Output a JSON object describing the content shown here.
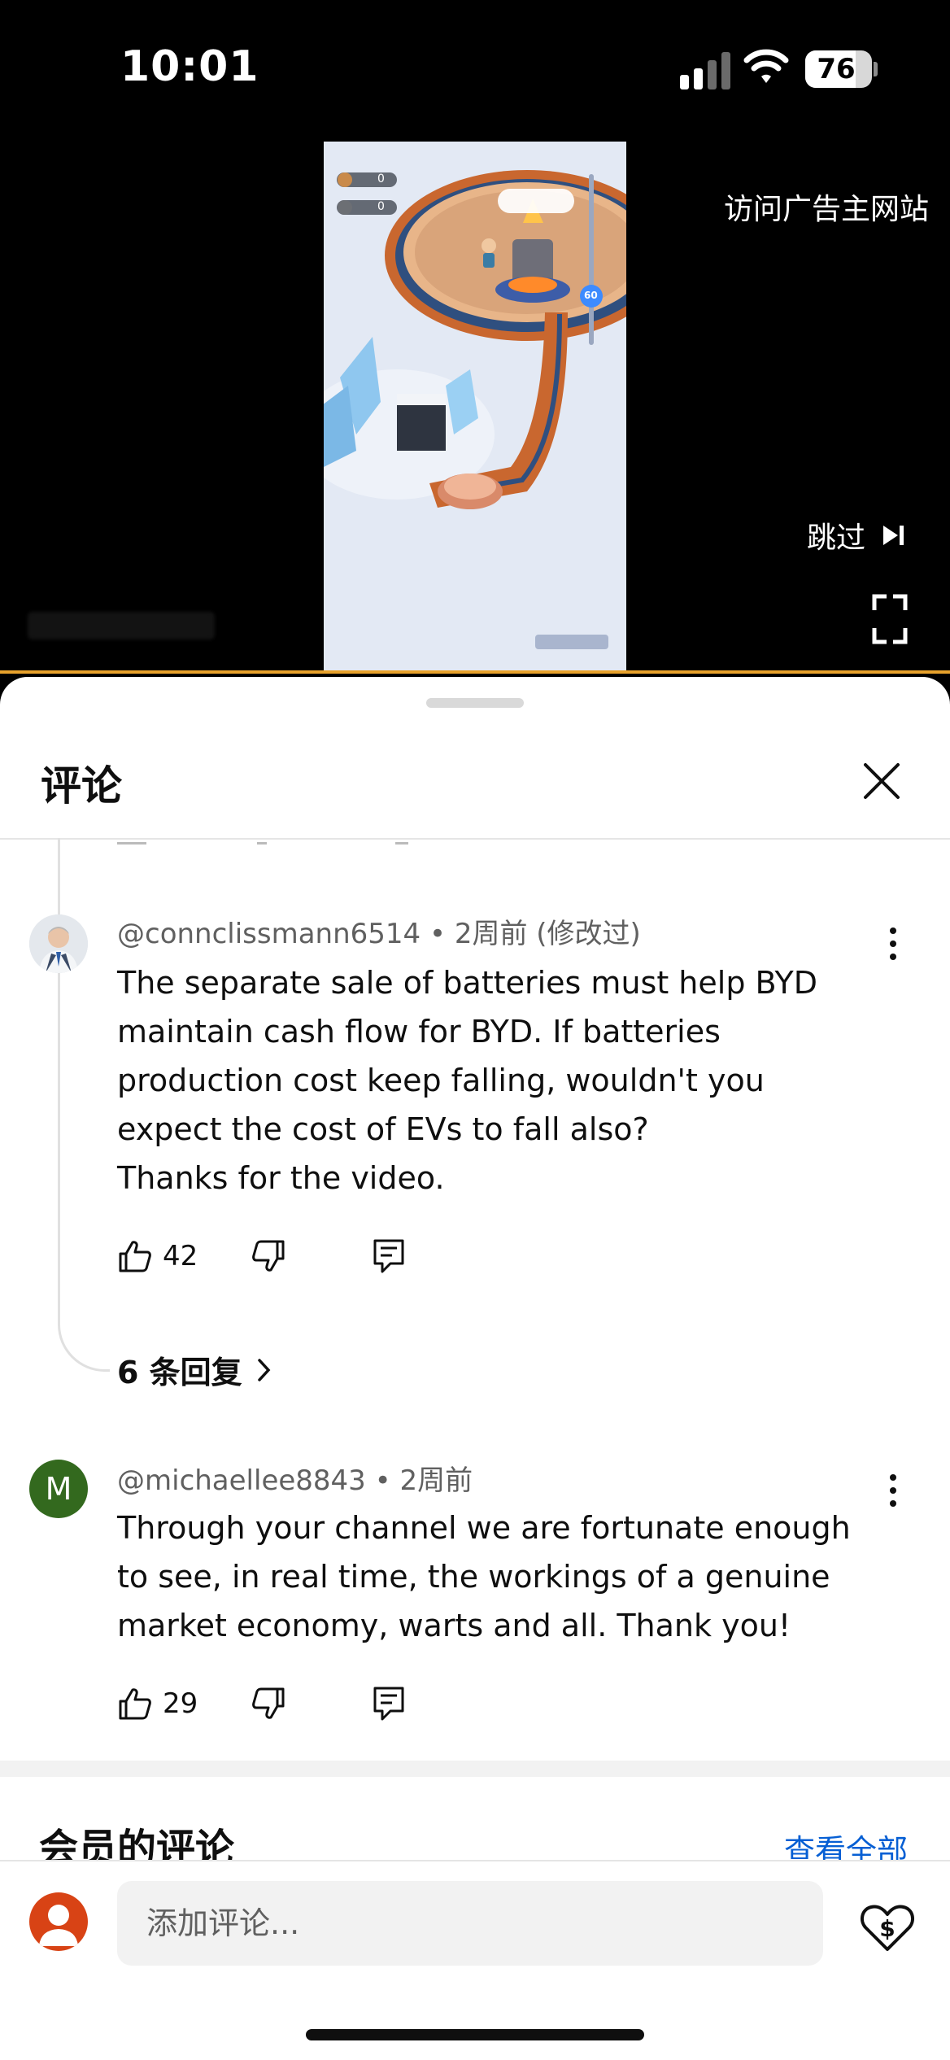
{
  "status_bar": {
    "time": "10:01",
    "battery_percent": "76",
    "battery_level": 0.76
  },
  "video": {
    "visit_advertiser_label": "访问广告主网站",
    "skip_label": "跳过",
    "ad_overlay_counts": [
      "0",
      "0"
    ],
    "ad_badge_value": "60"
  },
  "comments_panel": {
    "title": "评论",
    "comments": [
      {
        "author": "@connclissmann6514",
        "meta_suffix": " • 2周前 (修改过)",
        "lines": [
          "The separate sale of batteries must help BYD",
          "maintain cash flow for BYD. If batteries",
          "production cost keep falling, wouldn't you",
          "expect the cost of EVs to fall also?",
          "Thanks for the video."
        ],
        "likes": "42",
        "replies_label": "6 条回复"
      },
      {
        "author": "@michaellee8843",
        "meta_suffix": " • 2周前",
        "avatar_letter": "M",
        "lines": [
          "Through your channel we are fortunate enough",
          "to see, in real time, the workings of a genuine",
          "market economy, warts and all. Thank you!"
        ],
        "likes": "29"
      }
    ],
    "members_section": {
      "title": "会员的评论",
      "view_all_label": "查看全部"
    }
  },
  "composer": {
    "placeholder": "添加评论..."
  },
  "colors": {
    "accent_link": "#065fd4",
    "progress": "#e8a22c",
    "member_avatar": "#33691e",
    "my_avatar": "#d84315"
  },
  "icons": [
    "signal-icon",
    "wifi-icon",
    "battery-icon",
    "skip-next-icon",
    "fullscreen-icon",
    "close-icon",
    "more-vert-icon",
    "thumb-up-icon",
    "thumb-down-icon",
    "reply-icon",
    "chevron-right-icon",
    "super-thanks-icon"
  ]
}
